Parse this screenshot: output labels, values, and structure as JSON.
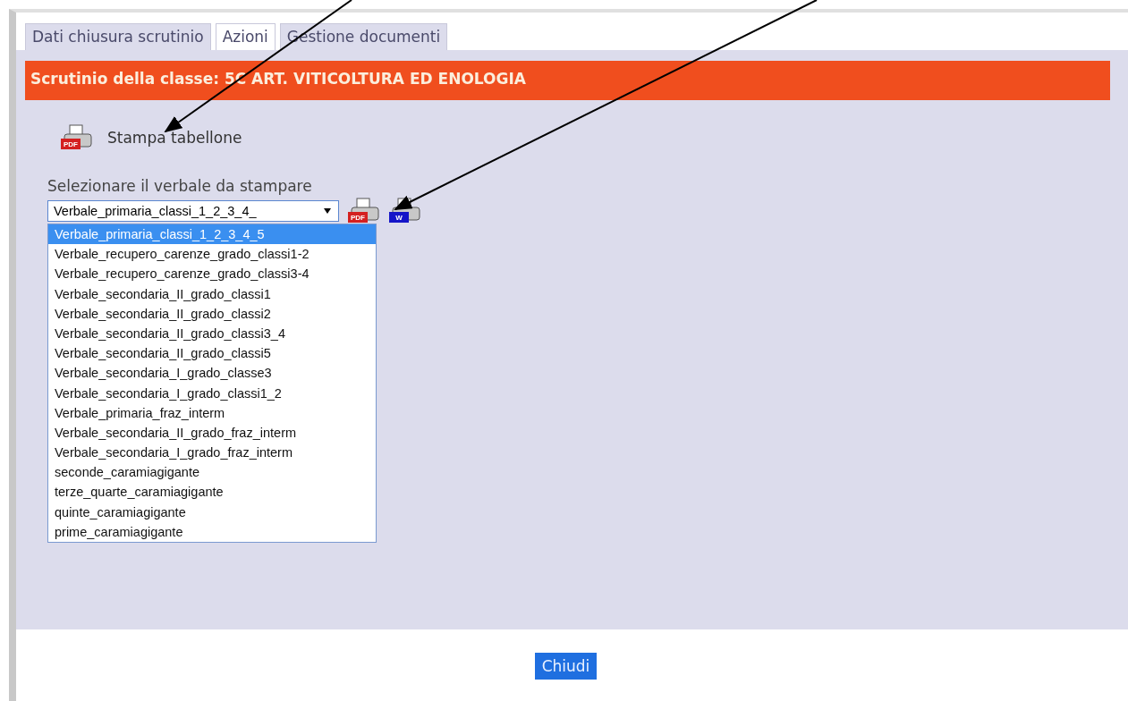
{
  "tabs": [
    {
      "label": "Dati chiusura scrutinio",
      "selected": false
    },
    {
      "label": "Azioni",
      "selected": true
    },
    {
      "label": "Gestione documenti",
      "selected": false
    }
  ],
  "header": "Scrutinio della classe: 5C ART. VITICOLTURA ED ENOLOGIA",
  "print_board": {
    "label": "Stampa tabellone",
    "icon_label": "PDF"
  },
  "report_select": {
    "label": "Selezionare il verbale da stampare",
    "value": "Verbale_primaria_classi_1_2_3_4_",
    "expanded": true,
    "options": [
      {
        "label": "Verbale_primaria_classi_1_2_3_4_5",
        "selected": true
      },
      {
        "label": "Verbale_recupero_carenze_grado_classi1-2",
        "selected": false
      },
      {
        "label": "Verbale_recupero_carenze_grado_classi3-4",
        "selected": false
      },
      {
        "label": "Verbale_secondaria_II_grado_classi1",
        "selected": false
      },
      {
        "label": "Verbale_secondaria_II_grado_classi2",
        "selected": false
      },
      {
        "label": "Verbale_secondaria_II_grado_classi3_4",
        "selected": false
      },
      {
        "label": "Verbale_secondaria_II_grado_classi5",
        "selected": false
      },
      {
        "label": "Verbale_secondaria_I_grado_classe3",
        "selected": false
      },
      {
        "label": "Verbale_secondaria_I_grado_classi1_2",
        "selected": false
      },
      {
        "label": "Verbale_primaria_fraz_interm",
        "selected": false
      },
      {
        "label": "Verbale_secondaria_II_grado_fraz_interm",
        "selected": false
      },
      {
        "label": "Verbale_secondaria_I_grado_fraz_interm",
        "selected": false
      },
      {
        "label": "seconde_caramiagigante",
        "selected": false
      },
      {
        "label": "terze_quarte_caramiagigante",
        "selected": false
      },
      {
        "label": "quinte_caramiagigante",
        "selected": false
      },
      {
        "label": "prime_caramiagigante",
        "selected": false
      }
    ],
    "export_buttons": [
      {
        "kind": "pdf",
        "label": "PDF"
      },
      {
        "kind": "word",
        "label": "W"
      }
    ]
  },
  "footer": {
    "close_button": "Chiudi"
  }
}
